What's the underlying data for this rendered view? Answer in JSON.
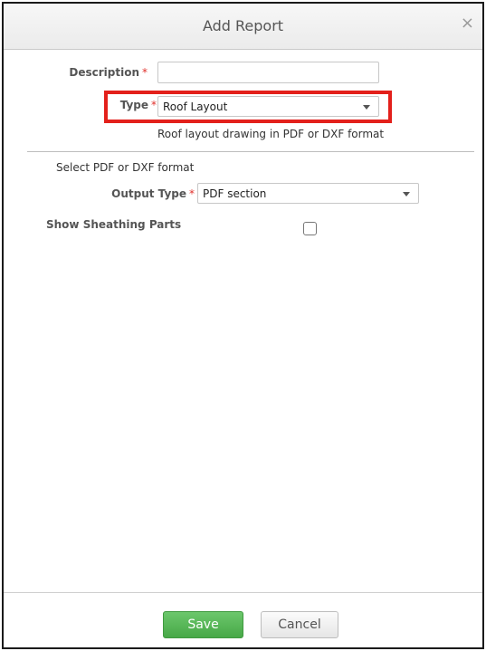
{
  "dialog": {
    "title": "Add Report",
    "close_symbol": "×"
  },
  "form": {
    "description": {
      "label": "Description",
      "required_mark": "*",
      "value": ""
    },
    "type": {
      "label": "Type",
      "required_mark": "*",
      "selected": "Roof Layout"
    },
    "type_hint": "Roof layout drawing in PDF or DXF format",
    "format_hint": "Select PDF or DXF format",
    "output_type": {
      "label": "Output Type",
      "required_mark": "*",
      "selected": "PDF section"
    },
    "show_sheathing": {
      "label": "Show Sheathing Parts",
      "checked": false
    }
  },
  "footer": {
    "save_label": "Save",
    "cancel_label": "Cancel"
  },
  "colors": {
    "required": "#e0302b",
    "highlight": "#e3201b",
    "save_button": "#5bb75b"
  },
  "icons": {
    "close": "close-icon",
    "dropdown": "chevron-down-icon"
  }
}
